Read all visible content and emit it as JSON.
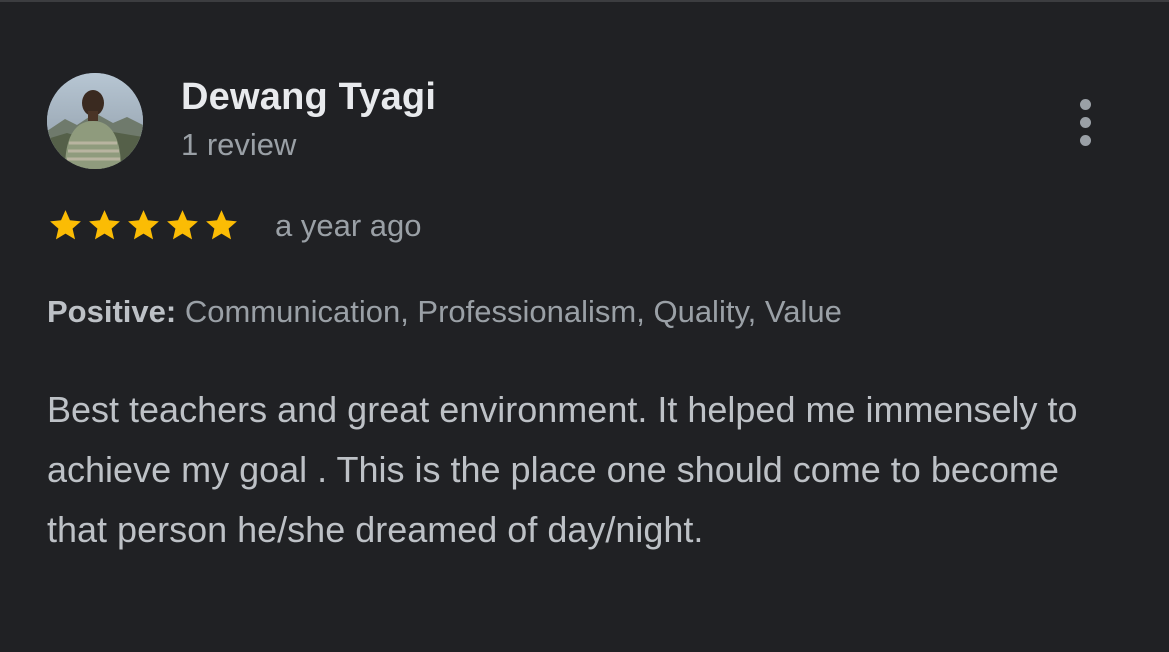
{
  "reviewer": {
    "name": "Dewang Tyagi",
    "review_count": "1 review"
  },
  "review": {
    "rating": 5,
    "max_rating": 5,
    "time_ago": "a year ago",
    "positive_label": "Positive:",
    "positive_items": "Communication, Professionalism, Quality, Value",
    "text": "Best teachers and great environment. It helped me immensely to achieve my goal . This is the place one should come to become that person he/she dreamed of day/night."
  },
  "icons": {
    "more": "more-vert-icon",
    "star": "star-icon"
  },
  "colors": {
    "background": "#202124",
    "star": "#fbbc04",
    "primary_text": "#e8eaed",
    "secondary_text": "#9aa0a6"
  }
}
